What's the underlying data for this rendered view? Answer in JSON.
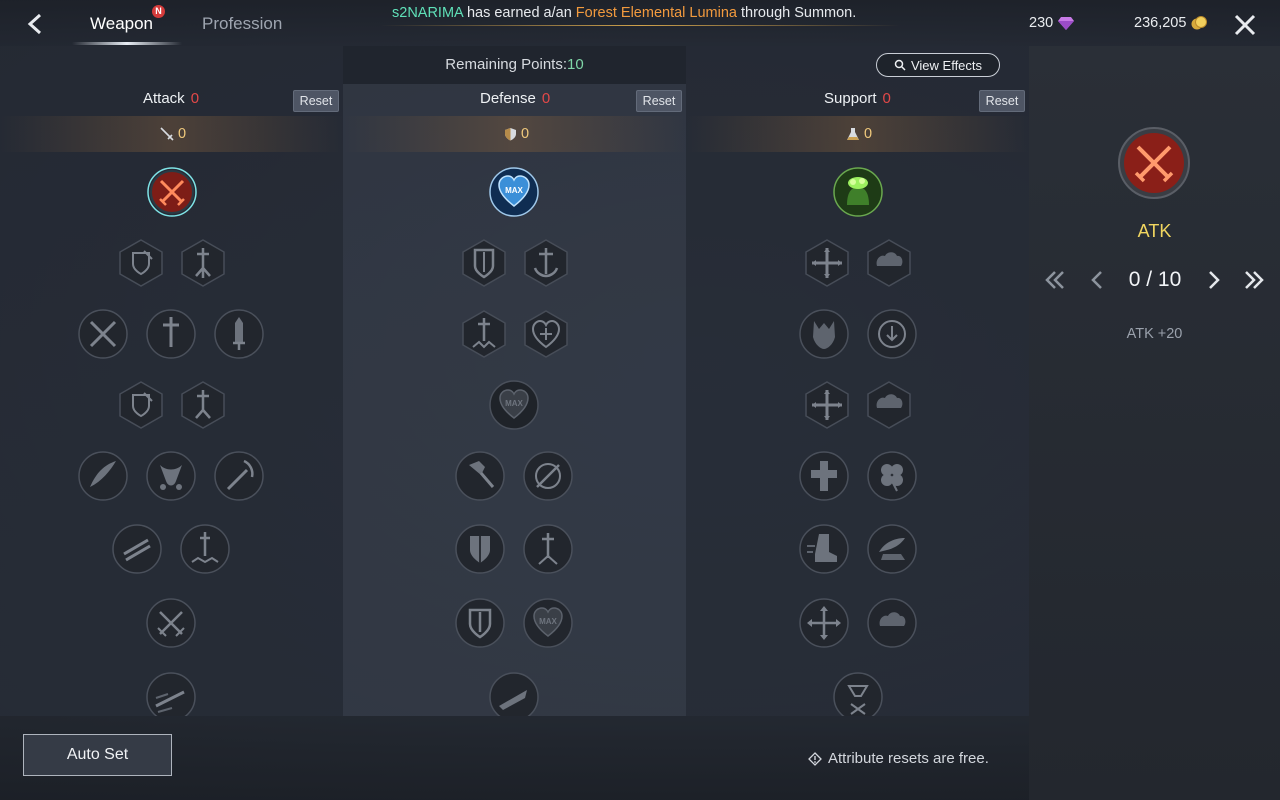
{
  "header": {
    "tabs": [
      {
        "label": "Weapon",
        "active": true,
        "badge": "N"
      },
      {
        "label": "Profession",
        "active": false
      }
    ],
    "notice": {
      "player": "s2NARIMA",
      "text_mid": "has earned a/an",
      "item": "Forest Elemental Lumina",
      "text_end": "through Summon."
    },
    "currency": {
      "gems": "230",
      "gold": "236,205"
    }
  },
  "panel": {
    "remaining_label": "Remaining Points:",
    "remaining_value": "10",
    "view_effects_label": "View Effects",
    "columns": [
      {
        "name": "Attack",
        "count": "0",
        "reset_label": "Reset",
        "stat_value": "0",
        "stat_icon": "sword-icon"
      },
      {
        "name": "Defense",
        "count": "0",
        "reset_label": "Reset",
        "stat_value": "0",
        "stat_icon": "shield-icon"
      },
      {
        "name": "Support",
        "count": "0",
        "reset_label": "Reset",
        "stat_value": "0",
        "stat_icon": "flask-icon"
      }
    ],
    "max_label": "MAX"
  },
  "footer": {
    "auto_set_label": "Auto Set",
    "hint": "Attribute resets are free."
  },
  "detail": {
    "name": "ATK",
    "level": "0 / 10",
    "effect": "ATK +20"
  },
  "colors": {
    "accent_gold": "#f1d660",
    "red_count": "#e24848",
    "green_points": "#7fd6a7",
    "player_name": "#5fe0b8",
    "item_name": "#f29a3e"
  }
}
